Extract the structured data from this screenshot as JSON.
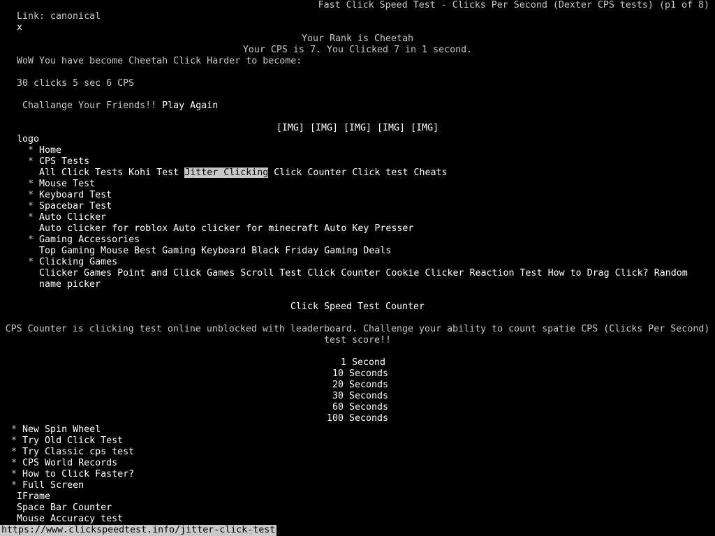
{
  "header": {
    "link_label": "Link: canonical",
    "close_x": "x",
    "title": "Fast Click Speed Test - Clicks Per Second (Dexter CPS tests) (p1 of 8)"
  },
  "result": {
    "rank": "Your Rank is Cheetah",
    "cps": "Your CPS is 7. You Clicked 7 in 1 second.",
    "wow": "WoW You have become Cheetah Click Harder to become:",
    "next_goal": "30 clicks 5 sec 6 CPS",
    "challenge": " Challange Your Friends!!",
    "play_again": "Play Again"
  },
  "images": [
    "[IMG]",
    "[IMG]",
    "[IMG]",
    "[IMG]",
    "[IMG]"
  ],
  "logo": "logo",
  "nav": {
    "bullet": "*",
    "home": "Home",
    "cps_tests": "CPS Tests",
    "cps_sub": [
      "All Click Tests",
      "Kohi Test",
      "Jitter Clicking",
      "Click Counter",
      "Click test Cheats"
    ],
    "mouse_test": "Mouse Test",
    "keyboard_test": "Keyboard Test",
    "spacebar_test": "Spacebar Test",
    "auto_clicker": "Auto Clicker",
    "auto_sub": [
      "Auto clicker for roblox",
      "Auto clicker for minecraft",
      "Auto Key Presser"
    ],
    "gaming_acc": "Gaming Accessories",
    "gaming_sub": [
      "Top Gaming Mouse",
      "Best Gaming Keyboard",
      "Black Friday Gaming Deals"
    ],
    "clicking_games": "Clicking Games",
    "clicking_sub_line1": [
      "Clicker Games",
      "Point and Click Games",
      "Scroll Test",
      "Click Counter",
      "Cookie Clicker",
      "Reaction Test",
      "How to Drag Click?",
      "Random"
    ],
    "clicking_sub_line2": "name picker"
  },
  "main": {
    "heading": "Click Speed Test Counter",
    "desc_line1": "CPS Counter is clicking test online unblocked with leaderboard. Challenge your ability to count spatie CPS (Clicks Per Second)",
    "desc_line2": "test score!!",
    "durations": [
      "  1 Second",
      " 10 Seconds",
      " 20 Seconds",
      " 30 Seconds",
      " 60 Seconds",
      "100 Seconds"
    ]
  },
  "footer_links": {
    "bullet": "*",
    "items": [
      "New Spin Wheel",
      "Try Old Click Test",
      "Try Classic cps test",
      "CPS World Records",
      "How to Click Faster?",
      "Full Screen"
    ],
    "plain": [
      "IFrame",
      "Space Bar Counter",
      "Mouse Accuracy test"
    ]
  },
  "status_url": "https://www.clickspeedtest.info/jitter-click-test"
}
